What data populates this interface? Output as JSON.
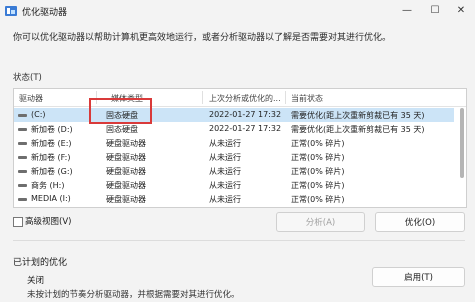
{
  "window": {
    "title": "优化驱动器",
    "controls": {
      "minimize": "—",
      "maximize": "☐",
      "close": "✕"
    }
  },
  "description": "你可以优化驱动器以帮助计算机更高效地运行，或者分析驱动器以了解是否需要对其进行优化。",
  "status_section": {
    "label": "状态(T)"
  },
  "table": {
    "headers": [
      "驱动器",
      "媒体类型",
      "上次分析或优化的...",
      "当前状态"
    ],
    "rows": [
      {
        "drive": "(C:)",
        "media": "固态硬盘",
        "last": "2022-01-27 17:32",
        "status": "需要优化(距上次重新剪裁已有 35 天)"
      },
      {
        "drive": "新加卷 (D:)",
        "media": "固态硬盘",
        "last": "2022-01-27 17:32",
        "status": "需要优化(距上次重新剪裁已有 35 天)"
      },
      {
        "drive": "新加卷 (E:)",
        "media": "硬盘驱动器",
        "last": "从未运行",
        "status": "正常(0% 碎片)"
      },
      {
        "drive": "新加卷 (F:)",
        "media": "硬盘驱动器",
        "last": "从未运行",
        "status": "正常(0% 碎片)"
      },
      {
        "drive": "新加卷 (G:)",
        "media": "硬盘驱动器",
        "last": "从未运行",
        "status": "正常(0% 碎片)"
      },
      {
        "drive": "商务 (H:)",
        "media": "硬盘驱动器",
        "last": "从未运行",
        "status": "正常(0% 碎片)"
      },
      {
        "drive": "MEDIA (I:)",
        "media": "硬盘驱动器",
        "last": "从未运行",
        "status": "正常(0% 碎片)"
      }
    ]
  },
  "advanced_view": {
    "label": "高级视图(V)"
  },
  "buttons": {
    "analyze": "分析(A)",
    "optimize": "优化(O)",
    "enable": "启用(T)"
  },
  "scheduled": {
    "title": "已计划的优化",
    "state": "关闭",
    "description": "未按计划的节奏分析驱动器，并根据需要对其进行优化。"
  },
  "colors": {
    "selected_row": "#cce4f7",
    "annotation": "#d93a3a"
  }
}
